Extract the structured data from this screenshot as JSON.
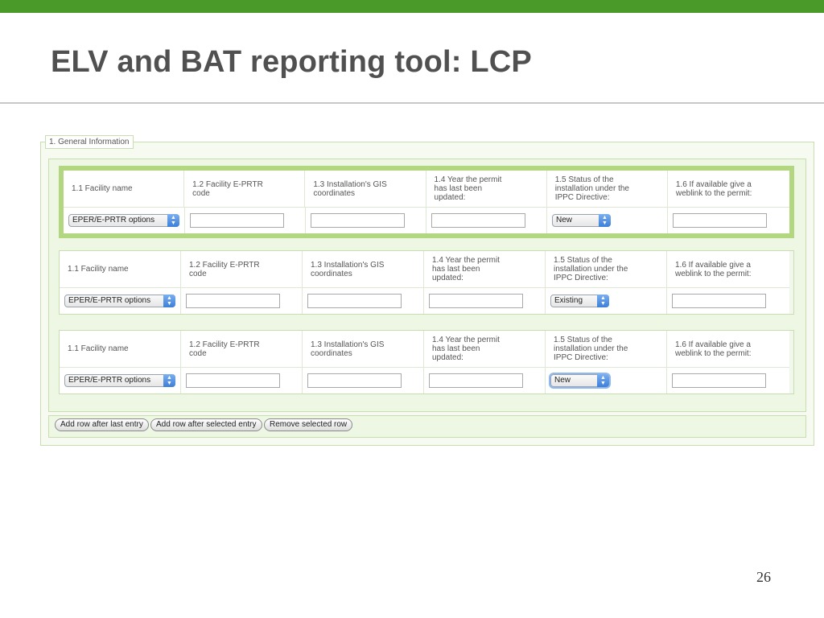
{
  "slide": {
    "title": "ELV and BAT reporting tool: LCP",
    "page_number": "26"
  },
  "colors": {
    "top_bar": "#4a9a2a",
    "title_text": "#505050",
    "panel_border": "#c8ddb0",
    "selected_row_highlight": "#b3d680",
    "select_arrow": "#3d7fd8"
  },
  "form": {
    "section_legend": "1. General Information",
    "columns": [
      "1.1 Facility name",
      "1.2 Facility E-PRTR\ncode",
      "1.3 Installation's GIS\ncoordinates",
      "1.4 Year the permit\nhas last been\nupdated:",
      "1.5 Status of the\ninstallation under the\nIPPC Directive:",
      "1.6 If available give a\nweblink to the permit:"
    ],
    "entries": [
      {
        "facility_select": "EPER/E-PRTR options",
        "eprtr_code": "",
        "gis_coordinates": "",
        "permit_year": "",
        "status_select": "New",
        "weblink": "",
        "selected": true
      },
      {
        "facility_select": "EPER/E-PRTR options",
        "eprtr_code": "",
        "gis_coordinates": "",
        "permit_year": "",
        "status_select": "Existing",
        "weblink": "",
        "selected": false
      },
      {
        "facility_select": "EPER/E-PRTR options",
        "eprtr_code": "",
        "gis_coordinates": "",
        "permit_year": "",
        "status_select": "New",
        "weblink": "",
        "selected": false
      }
    ],
    "buttons": {
      "add_after_last": "Add row after last entry",
      "add_after_selected": "Add row after selected entry",
      "remove_selected": "Remove selected row"
    }
  }
}
